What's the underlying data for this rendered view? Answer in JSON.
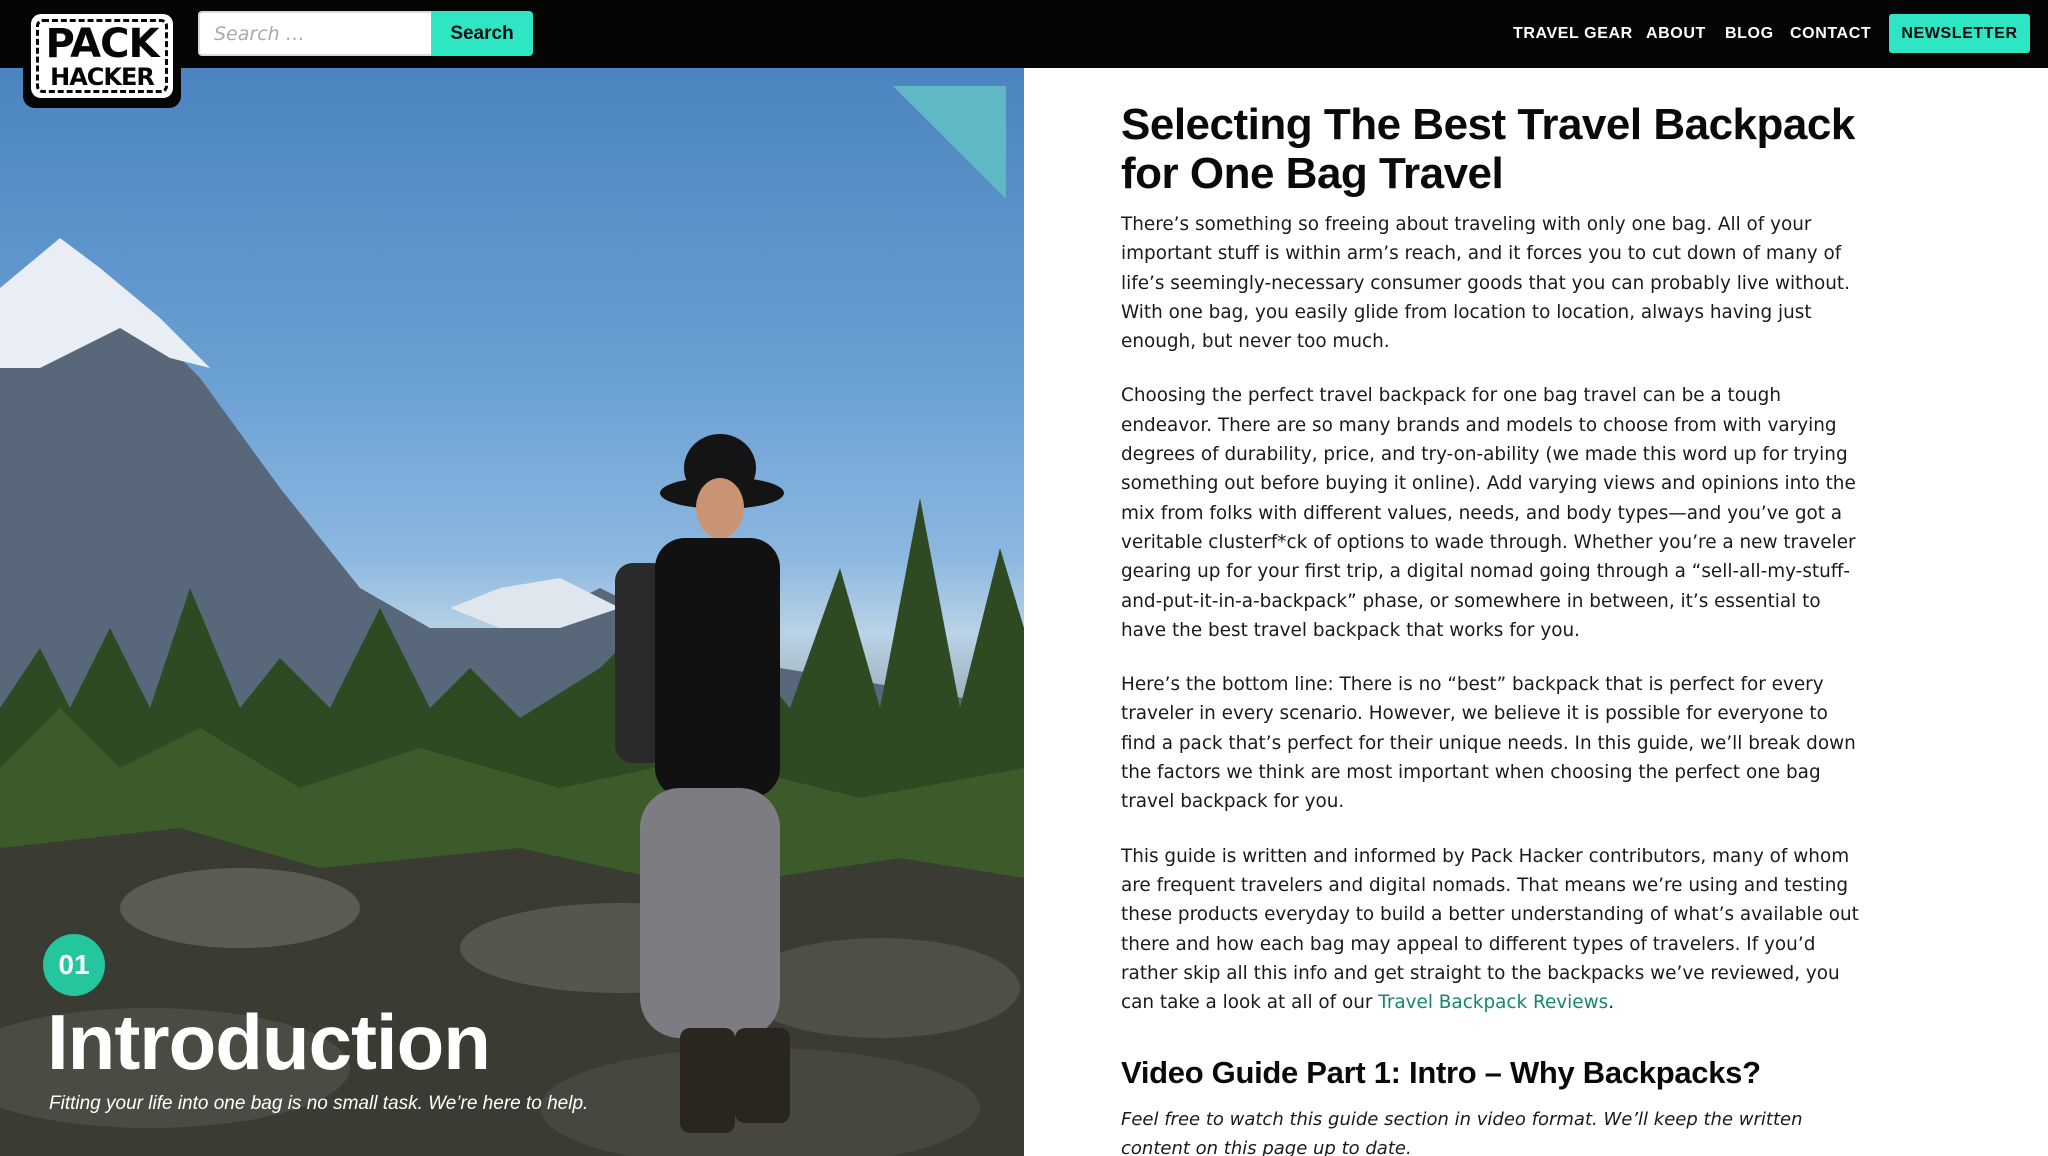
{
  "logo": {
    "line1": "PACK",
    "line2": "HACKER"
  },
  "search": {
    "placeholder": "Search …",
    "button_label": "Search"
  },
  "nav": {
    "items": [
      "TRAVEL GEAR",
      "ABOUT",
      "BLOG",
      "CONTACT"
    ],
    "newsletter_label": "NEWSLETTER"
  },
  "colors": {
    "accent": "#2ee6c4",
    "badge": "#25c69e",
    "link": "#16866a",
    "corner_triangle": "#5fb8c3",
    "topbar": "#050505"
  },
  "hero": {
    "section_number": "01",
    "section_title": "Introduction",
    "section_subtitle": "Fitting your life into one bag is no small task. We’re here to help."
  },
  "article": {
    "title": "Selecting The Best Travel Backpack for One Bag Travel",
    "paragraphs": [
      "There’s something so freeing about traveling with only one bag. All of your important stuff is within arm’s reach, and it forces you to cut down of many of life’s seemingly-necessary consumer goods that you can probably live without. With one bag, you easily glide from location to location, always having just enough, but never too much.",
      "Choosing the perfect travel backpack for one bag travel can be a tough endeavor. There are so many brands and models to choose from with varying degrees of durability, price, and try-on-ability (we made this word up for trying something out before buying it online). Add varying views and opinions into the mix from folks with different values, needs, and body types—and you’ve got a veritable clusterf*ck of options to wade through. Whether you’re a new traveler gearing up for your first trip, a digital nomad going through a “sell-all-my-stuff-and-put-it-in-a-backpack” phase, or somewhere in between, it’s essential to have the best travel backpack that works for you.",
      "Here’s the bottom line: There is no “best” backpack that is perfect for every traveler in every scenario. However, we believe it is possible for everyone to find a pack that’s perfect for their unique needs. In this guide, we’ll break down the factors we think are most important when choosing the perfect one bag travel backpack for you."
    ],
    "paragraph4_before_link": "This guide is written and informed by Pack Hacker contributors, many of whom are frequent travelers and digital nomads. That means we’re using and testing these products everyday to build a better understanding of what’s available out there and how each bag may appeal to different types of travelers. If you’d rather skip all this info and get straight to the backpacks we’ve reviewed, you can take a look at all of our ",
    "paragraph4_link": "Travel Backpack Reviews",
    "paragraph4_after_link": ".",
    "video_heading": "Video Guide Part 1: Intro – Why Backpacks?",
    "video_note": "Feel free to watch this guide section in video format. We’ll keep the written content on this page up to date."
  }
}
